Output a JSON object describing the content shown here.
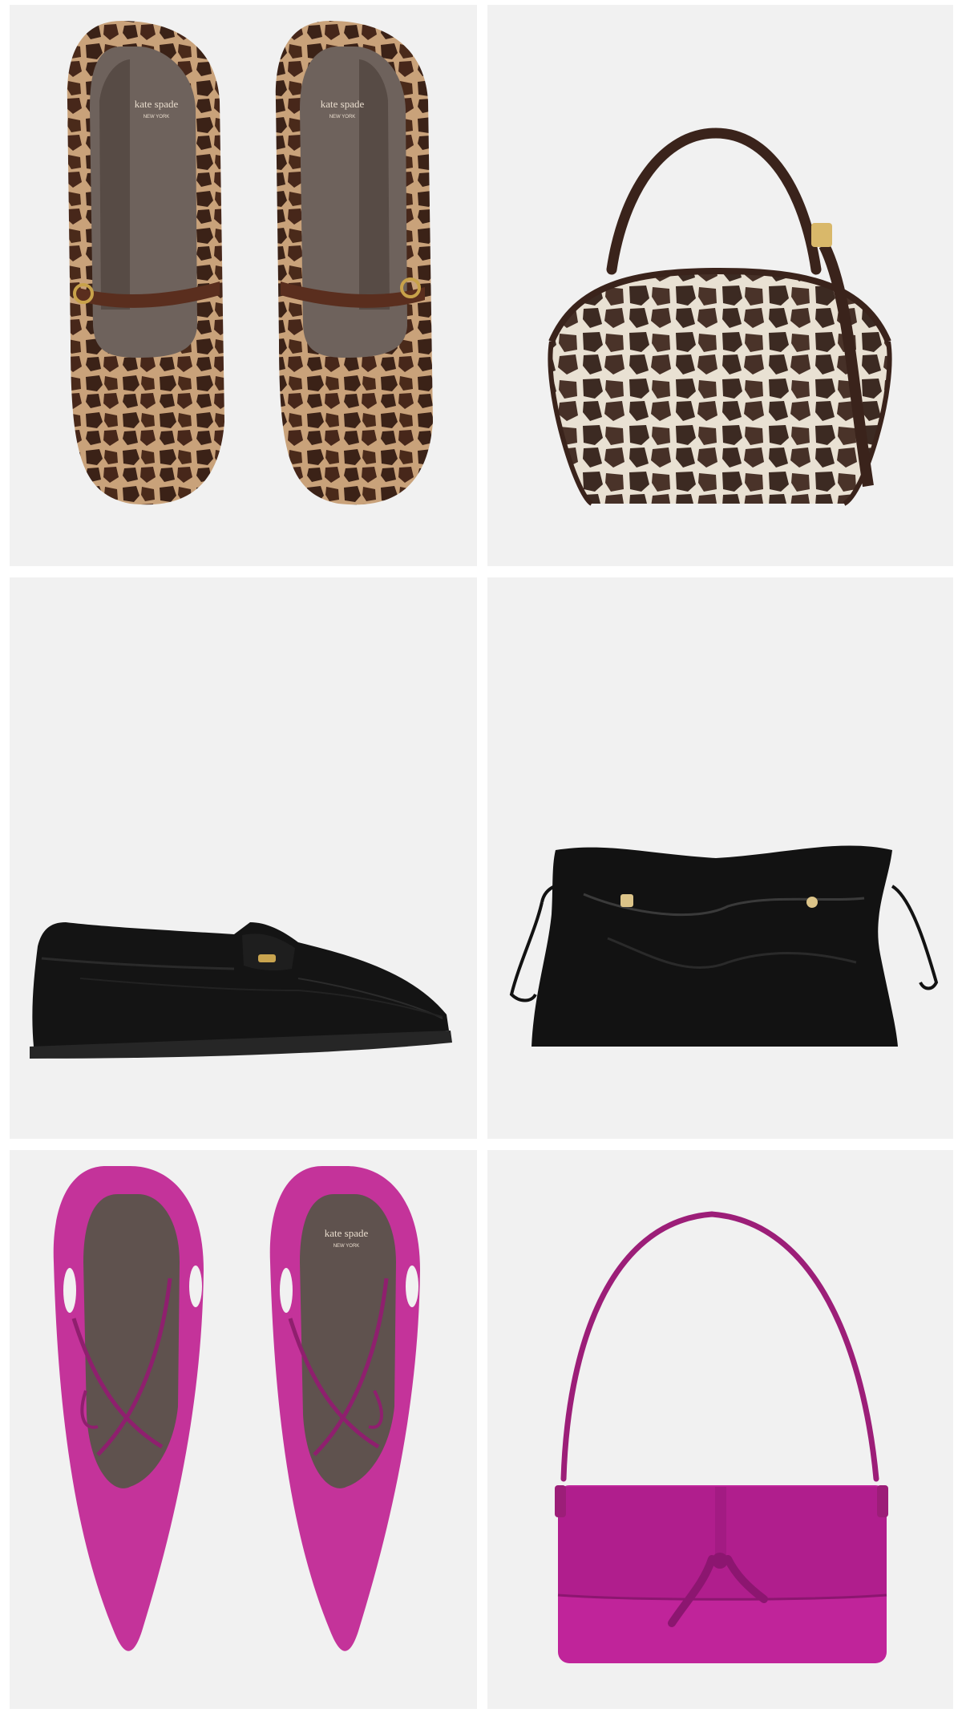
{
  "grid": {
    "background": "#f1f1f1",
    "items": [
      {
        "icon": "giraffe-print-mary-jane-flats-image",
        "colors": {
          "base": "#c9a27a",
          "spots": "#3b2217",
          "lining": "#6e625c",
          "strap": "#5a2e1e",
          "buckle": "#c8a24a"
        }
      },
      {
        "icon": "giraffe-print-shoulder-bag-image",
        "colors": {
          "base": "#e9e1d3",
          "spots": "#3c2a22",
          "trim": "#3a231b",
          "hardware": "#d9b86a"
        }
      },
      {
        "icon": "black-leather-penny-loafer-image",
        "colors": {
          "leather": "#141414",
          "sole": "#262626",
          "hardware": "#c9a44f"
        }
      },
      {
        "icon": "black-leather-drawstring-pouch-image",
        "colors": {
          "leather": "#121212",
          "highlight": "#3a3a3a",
          "hardware": "#dcc489"
        }
      },
      {
        "icon": "magenta-pointed-toe-flats-image",
        "colors": {
          "suede": "#c4339a",
          "dark": "#8f1f6e",
          "lining": "#5f524e"
        }
      },
      {
        "icon": "magenta-suede-shoulder-bag-image",
        "colors": {
          "suede": "#c0249a",
          "dark": "#8c1670",
          "strap": "#9c1e78"
        }
      }
    ]
  },
  "logo": {
    "brand": "kate spade",
    "city": "NEW YORK"
  }
}
